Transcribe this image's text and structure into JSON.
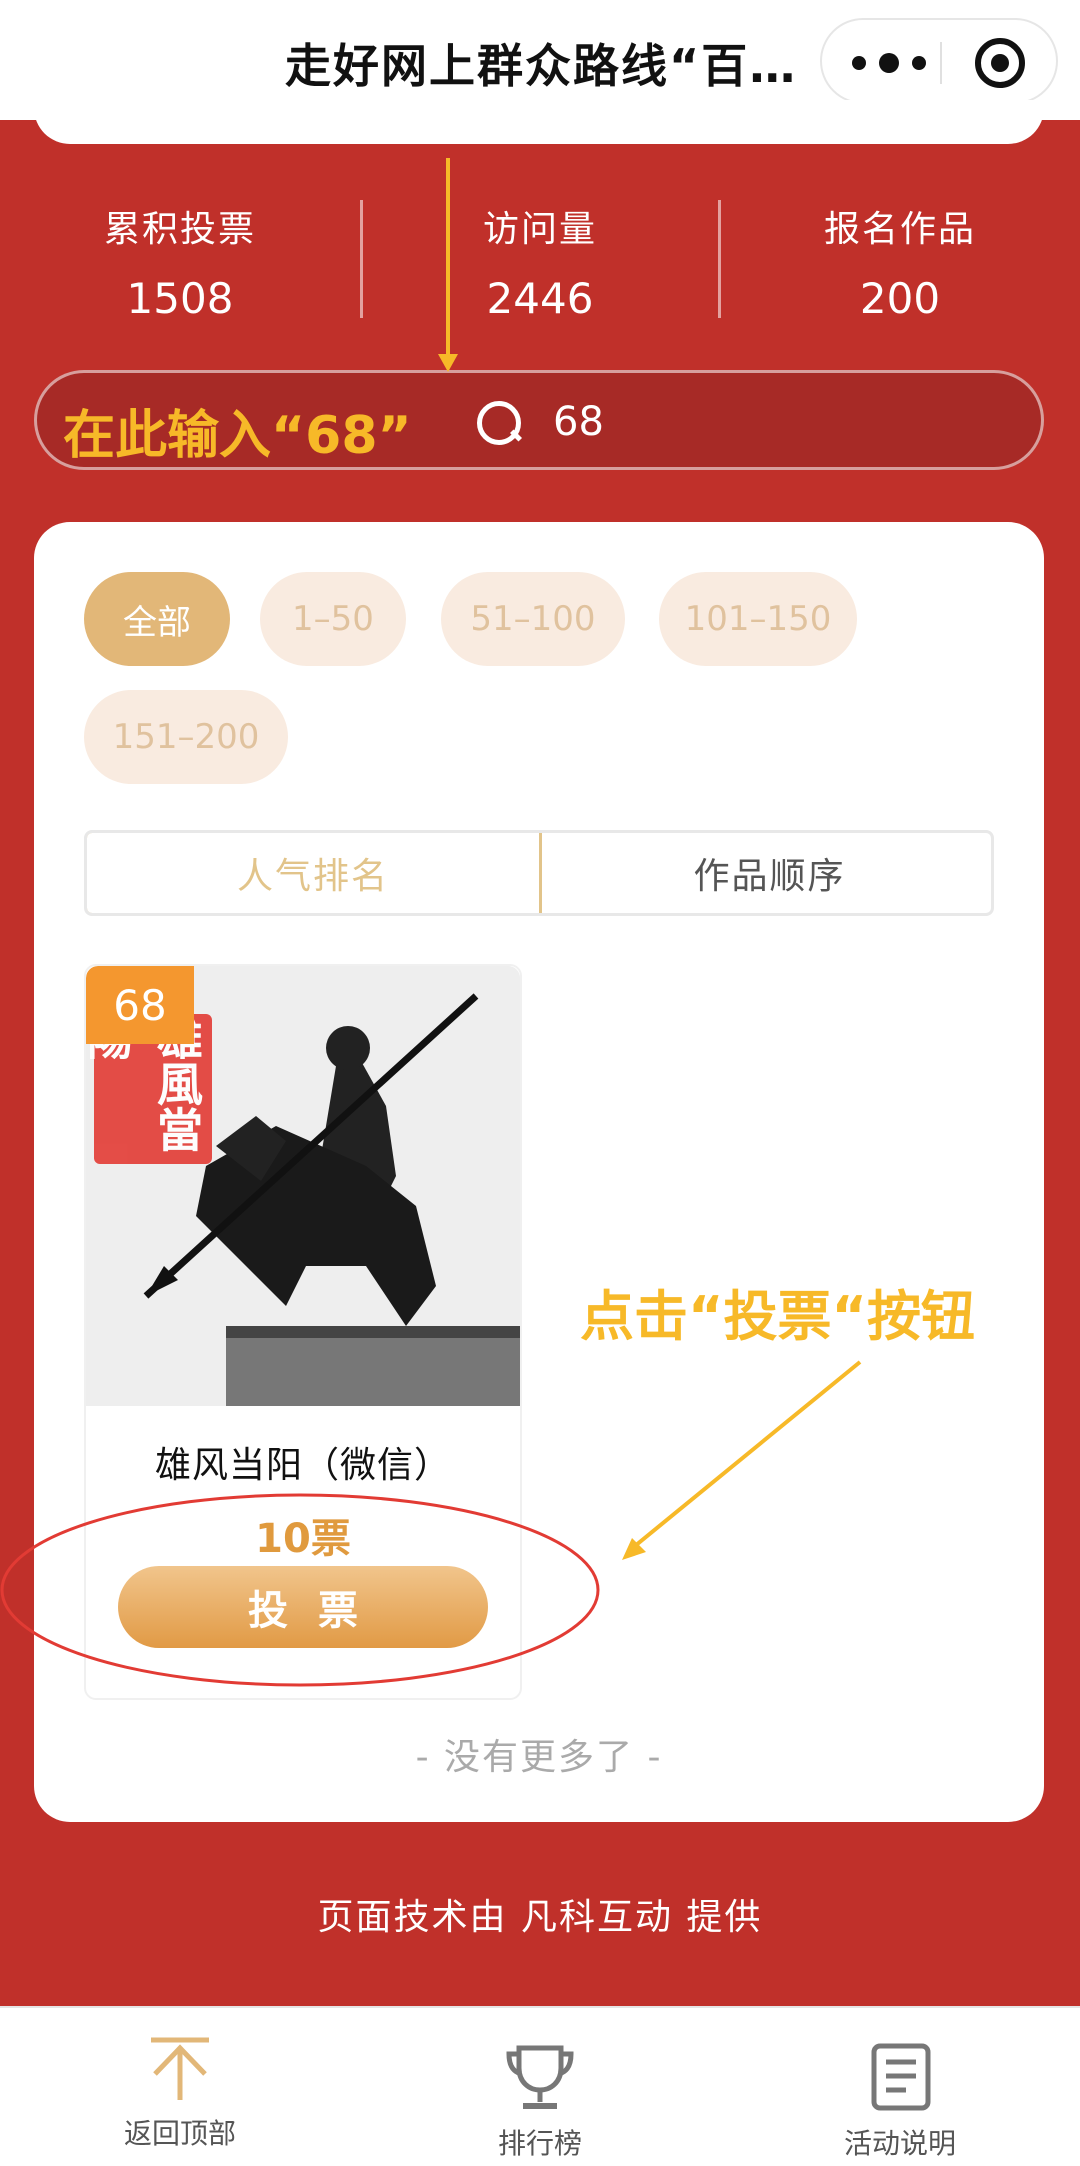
{
  "header": {
    "title": "走好网上群众路线“百…",
    "more_icon": "more-dots-icon",
    "close_icon": "target-circle-icon"
  },
  "stats": [
    {
      "label": "累积投票",
      "value": "1508"
    },
    {
      "label": "访问量",
      "value": "2446"
    },
    {
      "label": "报名作品",
      "value": "200"
    }
  ],
  "search": {
    "hint": "在此输入“68”",
    "value": "68",
    "icon": "search-icon"
  },
  "filters": [
    {
      "label": "全部",
      "active": true
    },
    {
      "label": "1–50",
      "active": false
    },
    {
      "label": "51–100",
      "active": false
    },
    {
      "label": "101–150",
      "active": false
    },
    {
      "label": "151–200",
      "active": false
    }
  ],
  "tabs": [
    {
      "label": "人气排名",
      "active": true
    },
    {
      "label": "作品顺序",
      "active": false
    }
  ],
  "work": {
    "number": "68",
    "name": "雄风当阳（微信）",
    "votes": "10票",
    "vote_button": "投票",
    "seal_text": "雄風當陽"
  },
  "no_more": "- 没有更多了 -",
  "annotation": "点击“投票“按钮",
  "footer_credit": "页面技术由 凡科互动 提供",
  "bottom_nav": [
    {
      "label": "返回顶部",
      "icon": "back-to-top-icon"
    },
    {
      "label": "排行榜",
      "icon": "trophy-icon"
    },
    {
      "label": "活动说明",
      "icon": "document-icon"
    }
  ],
  "colors": {
    "page_red": "#c0302a",
    "gold": "#e2b778",
    "orange": "#f4972f",
    "annotation_yellow": "#f7b928",
    "annotation_red": "#e23b34"
  }
}
